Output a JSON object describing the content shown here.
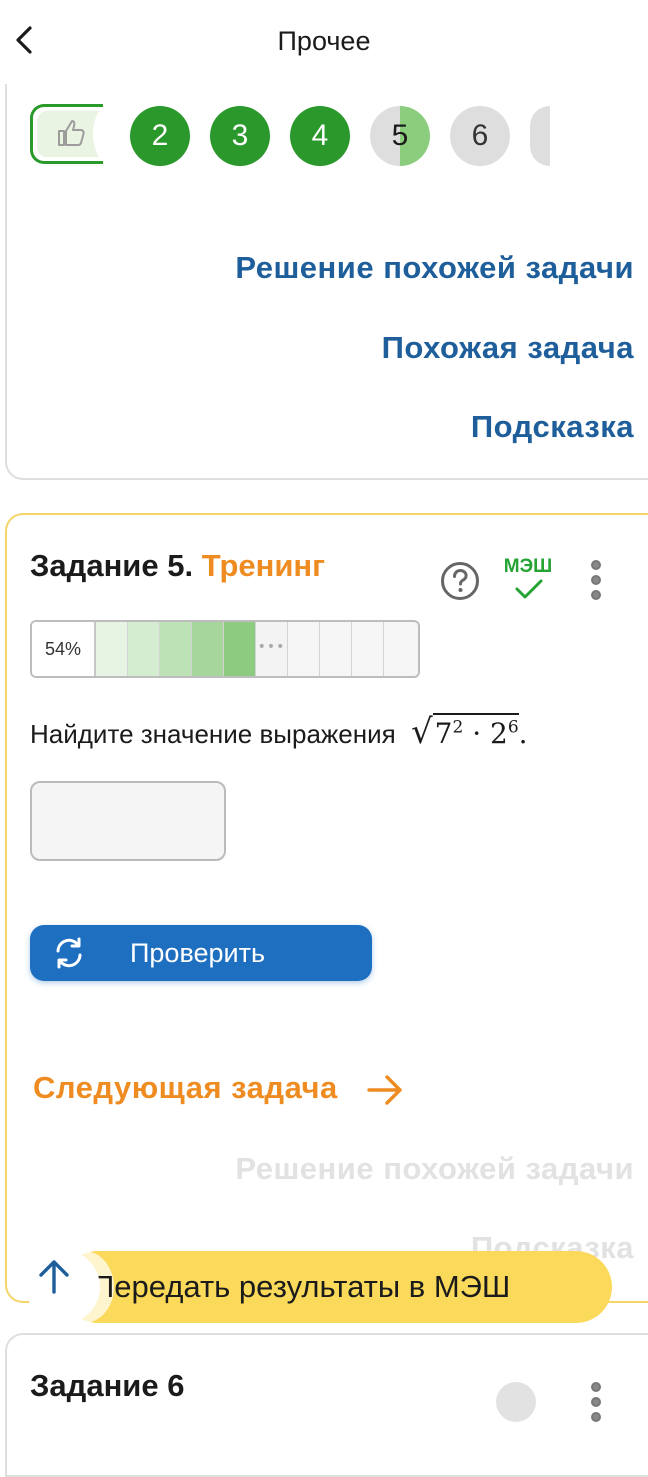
{
  "header": {
    "title": "Прочее"
  },
  "steps": [
    {
      "label": "2",
      "state": "done"
    },
    {
      "label": "3",
      "state": "done"
    },
    {
      "label": "4",
      "state": "done"
    },
    {
      "label": "5",
      "state": "current"
    },
    {
      "label": "6",
      "state": "todo"
    }
  ],
  "card1": {
    "solution_link": "Решение похожей задачи",
    "similar_link": "Похожая задача",
    "hint_link": "Подсказка"
  },
  "task": {
    "title_prefix": "Задание 5.",
    "title_type": "Тренинг",
    "mesh_label": "МЭШ",
    "progress": {
      "label": "54%",
      "value": 54
    },
    "problem_text": "Найдите значение выражения",
    "math": {
      "base1": "7",
      "exp1": "2",
      "op": "·",
      "base2": "2",
      "exp2": "6",
      "end": "."
    },
    "answer_value": "",
    "check_label": "Проверить",
    "next_label": "Следующая задача",
    "solution_link": "Решение похожей задачи",
    "hint_link": "Подсказка"
  },
  "send_button": {
    "label": "Передать результаты в МЭШ"
  },
  "task6": {
    "title": "Задание 6"
  },
  "colors": {
    "accent_blue": "#1e6fc0",
    "link_blue": "#1e5e9b",
    "orange": "#ee8c21",
    "green": "#2a982a",
    "yellow": "#fbd95a"
  }
}
